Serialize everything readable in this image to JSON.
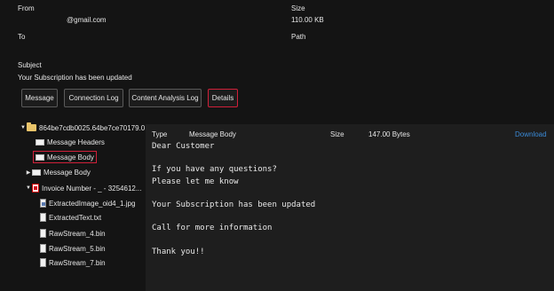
{
  "header": {
    "from_label": "From",
    "from_value": "@gmail.com",
    "to_label": "To",
    "size_label": "Size",
    "size_value": "110.00 KB",
    "path_label": "Path",
    "subject_label": "Subject",
    "subject_value": "Your Subscription has been updated"
  },
  "tabs": [
    {
      "label": "Message"
    },
    {
      "label": "Connection Log"
    },
    {
      "label": "Content Analysis Log"
    },
    {
      "label": "Details",
      "active": true
    }
  ],
  "tree": {
    "root": "864be7cdb0025.64be7ce70179.0...",
    "message_headers": "Message Headers",
    "message_body_selected": "Message Body",
    "message_body": "Message Body",
    "invoice": "Invoice Number - _ - 3254612...",
    "extracted_image": "ExtractedImage_oid4_1.jpg",
    "extracted_text": "ExtractedText.txt",
    "raw4": "RawStream_4.bin",
    "raw5": "RawStream_5.bin",
    "raw7": "RawStream_7.bin"
  },
  "detail": {
    "type_label": "Type",
    "type_value": "Message Body",
    "size_label": "Size",
    "size_value": "147.00 Bytes",
    "download_label": "Download",
    "body": "Dear Customer\n\nIf you have any questions?\nPlease let me know\n\nYour Subscription has been updated\n\nCall for more information\n\nThank you!!"
  },
  "colors": {
    "background": "#141414",
    "panel": "#1e1e1e",
    "active_outline": "#d0203a",
    "link": "#3a8ad6"
  }
}
